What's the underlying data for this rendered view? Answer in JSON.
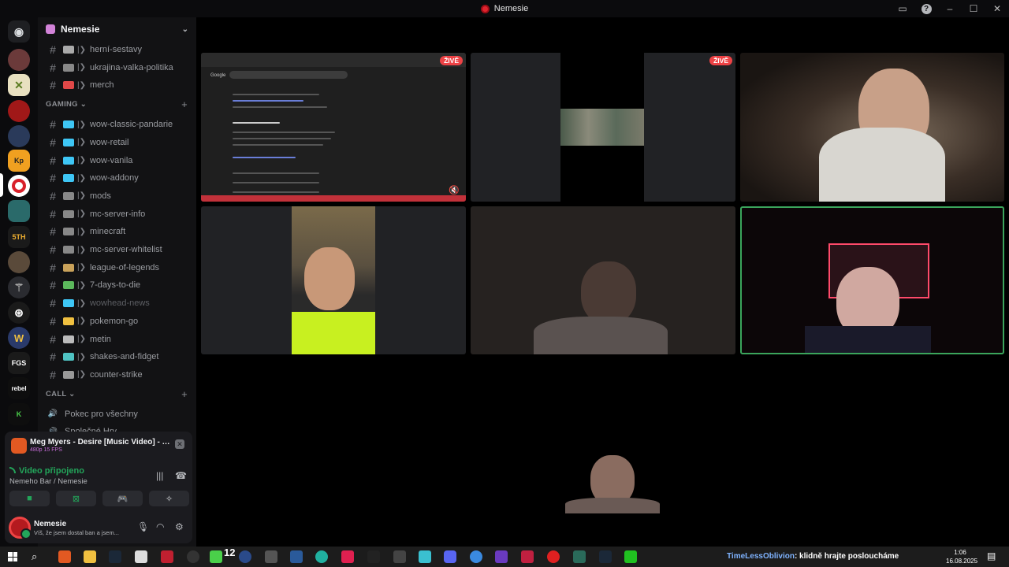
{
  "window": {
    "title": "Nemesie"
  },
  "guild": {
    "name": "Nemesie"
  },
  "channels_top": [
    {
      "name": "herní-sestavy",
      "emoji": "#aaaaaa"
    },
    {
      "name": "ukrajina-valka-politika",
      "emoji": "#888888"
    },
    {
      "name": "merch",
      "emoji": "#e04848"
    }
  ],
  "categories": {
    "gaming": "GAMING",
    "call": "CALL"
  },
  "channels_gaming": [
    {
      "name": "wow-classic-pandarie",
      "emoji": "#3ec6f5"
    },
    {
      "name": "wow-retail",
      "emoji": "#3ec6f5"
    },
    {
      "name": "wow-vanila",
      "emoji": "#3ec6f5"
    },
    {
      "name": "wow-addony",
      "emoji": "#3ec6f5"
    },
    {
      "name": "mods",
      "emoji": "#888888"
    },
    {
      "name": "mc-server-info",
      "emoji": "#888888"
    },
    {
      "name": "minecraft",
      "emoji": "#888888"
    },
    {
      "name": "mc-server-whitelist",
      "emoji": "#888888"
    },
    {
      "name": "league-of-legends",
      "emoji": "#c9a25a"
    },
    {
      "name": "7-days-to-die",
      "emoji": "#5cb85c"
    },
    {
      "name": "wowhead-news",
      "emoji": "#3ec6f5"
    },
    {
      "name": "pokemon-go",
      "emoji": "#f0c040"
    },
    {
      "name": "metin",
      "emoji": "#bbbbbb"
    },
    {
      "name": "shakes-and-fidget",
      "emoji": "#4fc3c3"
    },
    {
      "name": "counter-strike",
      "emoji": "#999999"
    }
  ],
  "channels_call": [
    {
      "name": "Pokec pro všechny"
    },
    {
      "name": "Společné Hry"
    }
  ],
  "activity": {
    "title": "Meg Myers - Desire [Music Video] - YouTu...",
    "subtitle": "480p 15 FPS"
  },
  "voice": {
    "status": "Video připojeno",
    "channel": "Nemeho Bar / Nemesie"
  },
  "user": {
    "name": "Nemesie",
    "status": "Víš, že jsem dostal ban a jsem..."
  },
  "stage": {
    "live_badge": "ŽIVĚ"
  },
  "taskbar": {
    "badge_count": "12",
    "marquee_name": "TimeLessOblivion",
    "marquee_text": ": klidně hrajte posloucháme",
    "time": "1:06",
    "date": "16.08.2025"
  },
  "colors": {
    "accent_green": "#23a55a",
    "live_red": "#ed4245",
    "speaking_border": "#3ba55c"
  }
}
